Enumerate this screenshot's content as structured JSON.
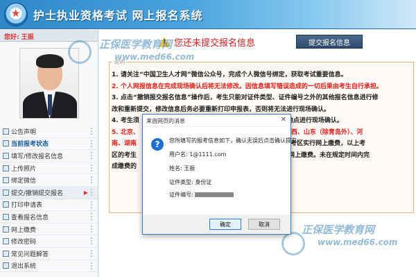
{
  "header": {
    "title": "护士执业资格考试 网上报名系统"
  },
  "sidebar": {
    "greeting": "您好: 王振",
    "menu": [
      {
        "label": "公告声明"
      },
      {
        "label": "当前报考状态"
      },
      {
        "label": "填写/修改报名信息"
      },
      {
        "label": "上传照片"
      },
      {
        "label": "绑定微信"
      },
      {
        "label": "提交/撤销提交报名"
      },
      {
        "label": "打印申请表"
      },
      {
        "label": "查看报名信息"
      },
      {
        "label": "网上缴费"
      },
      {
        "label": "修改密码"
      },
      {
        "label": "常见问题解答"
      },
      {
        "label": "退出系统"
      }
    ]
  },
  "main": {
    "status_text": "您还未提交报名信息",
    "submit_button": "提交报名信息",
    "notice_label": "说明",
    "notice_lines": [
      "1. 请关注“中国卫生人才网”微信公众号，完成个人微信号绑定，获取考试重要信息。",
      "2. 个人网报信息在完成现场确认后将无法修改。因信息填写错误造成的一切后果由考生自行承担。",
      "3. 点击“撤销报交报名信息”操作后，考生只能对证件类型、证件编号之外的其他报名信息进行修",
      "改和重新提交，修改信息后务必要重新打印申报表，否则将无法进行现场确认。",
      "4. 考生须",
      "5. 北京、",
      "南、湖南",
      "区的考生",
      "成缴费的"
    ],
    "notice_right": [
      "构指定地点进行现场确认。",
      "建、江西、山东（除青岛外）、河",
      "疆兵团 考区实行网上缴费，以上考",
      "日完成网上缴费。未在规定时间内完"
    ]
  },
  "dialog": {
    "title": "来自网页的消息",
    "message": "您所填写的报考信息如下，确认无误后点击确认提交。",
    "username": "用户名: 1@1111.com",
    "name": "姓名: 王振",
    "id_type": "证件类型: 身份证",
    "id_no_label": "证件编号:",
    "ok": "确定",
    "cancel": "取消"
  },
  "watermark": {
    "text": "正保医学教育网",
    "url": "www.med66.com"
  }
}
